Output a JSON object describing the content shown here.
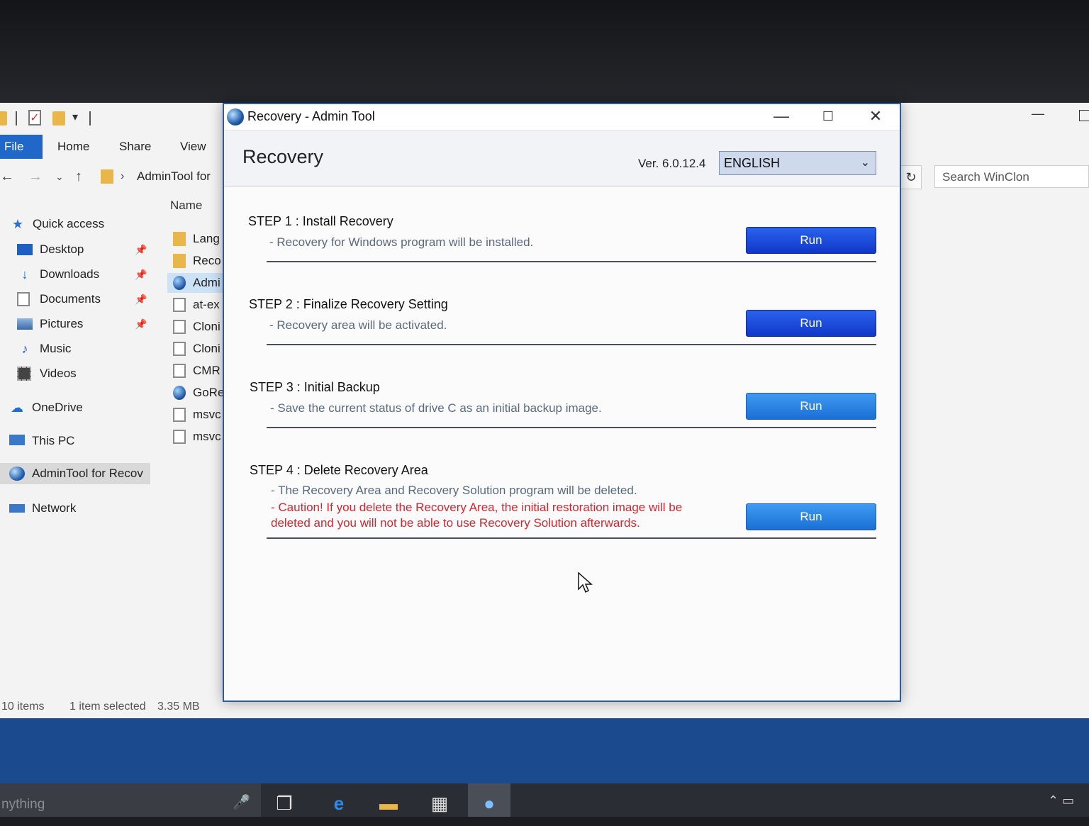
{
  "explorer": {
    "ribbon_tabs": [
      "File",
      "Home",
      "Share",
      "View"
    ],
    "address": "AdminTool for",
    "search_placeholder": "Search WinClon",
    "column_header": "Name",
    "sidebar": [
      {
        "label": "Quick access",
        "icon": "star-icon"
      },
      {
        "label": "Desktop",
        "icon": "desktop-icon",
        "pinned": true
      },
      {
        "label": "Downloads",
        "icon": "download-arrow-icon",
        "pinned": true
      },
      {
        "label": "Documents",
        "icon": "document-icon",
        "pinned": true
      },
      {
        "label": "Pictures",
        "icon": "pictures-icon",
        "pinned": true
      },
      {
        "label": "Music",
        "icon": "music-note-icon"
      },
      {
        "label": "Videos",
        "icon": "film-icon"
      },
      {
        "label": "OneDrive",
        "icon": "cloud-icon"
      },
      {
        "label": "This PC",
        "icon": "computer-icon"
      },
      {
        "label": "AdminTool for Recov",
        "icon": "globe-icon"
      },
      {
        "label": "Network",
        "icon": "network-icon"
      }
    ],
    "files": [
      {
        "name": "Lang",
        "icon": "folder"
      },
      {
        "name": "Reco",
        "icon": "folder"
      },
      {
        "name": "Admi",
        "icon": "globe"
      },
      {
        "name": "at-ex",
        "icon": "doc"
      },
      {
        "name": "Cloni",
        "icon": "doc"
      },
      {
        "name": "Cloni",
        "icon": "doc"
      },
      {
        "name": "CMR",
        "icon": "doc"
      },
      {
        "name": "GoRe",
        "icon": "globe"
      },
      {
        "name": "msvc",
        "icon": "doc"
      },
      {
        "name": "msvc",
        "icon": "doc"
      }
    ],
    "status": {
      "count": "10 items",
      "selected": "1 item selected",
      "size": "3.35 MB"
    }
  },
  "dialog": {
    "window_title": "Recovery - Admin Tool",
    "header_title": "Recovery",
    "version": "Ver. 6.0.12.4",
    "language": "ENGLISH",
    "steps": [
      {
        "title": "STEP 1 : Install Recovery",
        "desc": "- Recovery for Windows program will be installed.",
        "button": "Run"
      },
      {
        "title": "STEP 2 : Finalize Recovery Setting",
        "desc": "- Recovery area will be activated.",
        "button": "Run"
      },
      {
        "title": "STEP 3 : Initial Backup",
        "desc": "- Save the current status of drive C as an initial backup image.",
        "button": "Run"
      },
      {
        "title": "STEP 4 : Delete Recovery Area",
        "desc": "- The Recovery Area and Recovery Solution program will be deleted.",
        "warning": "- Caution! If you delete the Recovery Area, the initial restoration image will be deleted and you will not be able to use Recovery Solution afterwards.",
        "button": "Run"
      }
    ]
  },
  "taskbar": {
    "search_text": "nything",
    "accent": "#2a62ec"
  }
}
